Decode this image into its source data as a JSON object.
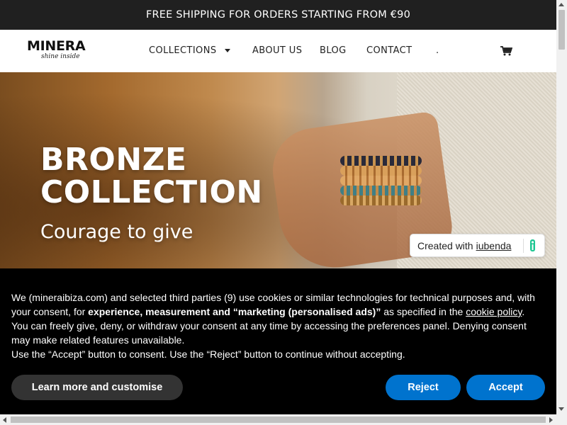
{
  "topbar": {
    "text": "FREE SHIPPING FOR ORDERS STARTING FROM €90"
  },
  "brand": {
    "name": "MINERA",
    "tagline": "shine inside"
  },
  "nav": {
    "items": [
      {
        "label": "COLLECTIONS",
        "has_dropdown": true
      },
      {
        "label": "ABOUT US"
      },
      {
        "label": "BLOG"
      },
      {
        "label": "CONTACT"
      },
      {
        "label": "."
      }
    ],
    "cart_icon": "shopping-cart-icon"
  },
  "hero": {
    "title_line1": "BRONZE",
    "title_line2": "COLLECTION",
    "subtitle": "Courage to give"
  },
  "iubenda": {
    "prefix": "Created with",
    "link": "iubenda"
  },
  "cookie": {
    "p1_a": "We (mineraibiza.com) and selected third parties (9) use cookies or similar technologies for technical purposes and, with your consent, for ",
    "p1_bold": "experience, measurement and “marketing (personalised ads)”",
    "p1_b": " as specified in the ",
    "p1_link": "cookie policy",
    "p1_c": ".",
    "p2": "You can freely give, deny, or withdraw your consent at any time by accessing the preferences panel. Denying consent may make related features unavailable.",
    "p3": "Use the “Accept” button to consent. Use the “Reject” button to continue without accepting.",
    "learn_more": "Learn more and customise",
    "reject": "Reject",
    "accept": "Accept"
  },
  "colors": {
    "topbar_bg": "#202020",
    "button_blue": "#0073ce",
    "cookie_bg": "#000000"
  }
}
